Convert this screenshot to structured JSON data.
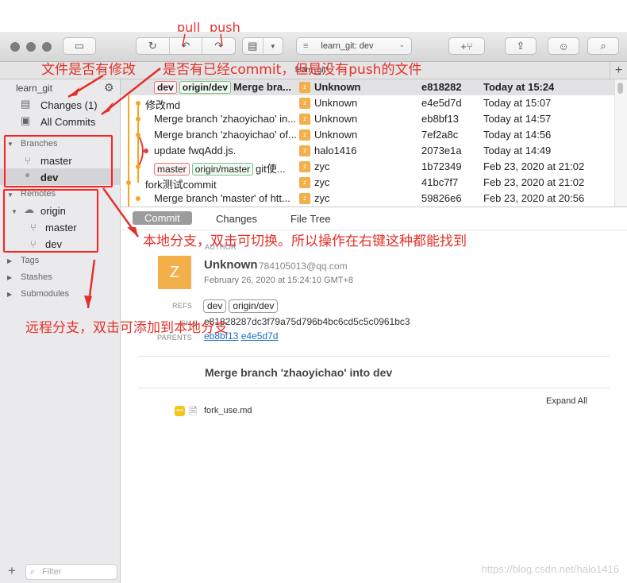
{
  "annotations": {
    "pull": "pull",
    "push": "push",
    "file_modified": "文件是否有修改",
    "committed_not_pushed": "是否有已经commit，但是没有push的文件",
    "local_branch_note": "本地分支，双击可切换。所以操作在右键这种都能找到",
    "remote_branch_note": "远程分支，双击可添加到本地分支",
    "accent": "#e5302a"
  },
  "toolbar": {
    "branch_select": "learn_git: dev",
    "icons": [
      "sidebar-toggle-icon",
      "fetch-icon",
      "pull-icon",
      "push-icon",
      "stash-icon",
      "branch-icon",
      "share-icon",
      "smiley-icon",
      "search-icon"
    ]
  },
  "tab": {
    "title": "learn_git*"
  },
  "sidebar": {
    "repo": "learn_git",
    "changes": "Changes (1)",
    "all_commits": "All Commits",
    "branches_header": "Branches",
    "branches": [
      "master",
      "dev"
    ],
    "remotes_header": "Remotes",
    "remote_name": "origin",
    "remote_branches": [
      "master",
      "dev"
    ],
    "tags": "Tags",
    "stashes": "Stashes",
    "submodules": "Submodules",
    "filter_placeholder": "Filter",
    "add": "+"
  },
  "commits": [
    {
      "tags": [
        {
          "t": "dev",
          "k": "local"
        },
        {
          "t": "origin/dev",
          "k": "remote"
        }
      ],
      "message": "Merge bra...",
      "avatar": "z",
      "author": "Unknown",
      "hash": "e818282",
      "date": "Today at 15:24"
    },
    {
      "tags": [],
      "message": "修改md",
      "avatar": "z",
      "author": "Unknown",
      "hash": "e4e5d7d",
      "date": "Today at 15:07"
    },
    {
      "tags": [],
      "message": "Merge branch 'zhaoyichao' in...",
      "avatar": "z",
      "author": "Unknown",
      "hash": "eb8bf13",
      "date": "Today at 14:57"
    },
    {
      "tags": [],
      "message": "Merge branch 'zhaoyichao' of...",
      "avatar": "z",
      "author": "Unknown",
      "hash": "7ef2a8c",
      "date": "Today at 14:56"
    },
    {
      "tags": [],
      "message": "update fwqAdd.js.",
      "avatar": "z",
      "author": "halo1416",
      "hash": "2073e1a",
      "date": "Today at 14:49"
    },
    {
      "tags": [
        {
          "t": "master",
          "k": "local"
        },
        {
          "t": "origin/master",
          "k": "remote"
        }
      ],
      "message": "git使...",
      "avatar": "z",
      "author": "zyc",
      "hash": "1b72349",
      "date": "Feb 23, 2020 at 21:02"
    },
    {
      "tags": [],
      "message": "fork测试commit",
      "avatar": "z",
      "author": "zyc",
      "hash": "41bc7f7",
      "date": "Feb 23, 2020 at 21:02"
    },
    {
      "tags": [],
      "message": "Merge branch 'master' of htt...",
      "avatar": "z",
      "author": "zyc",
      "hash": "59826e6",
      "date": "Feb 23, 2020 at 20:56"
    }
  ],
  "detail_tabs": [
    "Commit",
    "Changes",
    "File Tree"
  ],
  "detail": {
    "author_label": "AUTHOR",
    "avatar": "Z",
    "author_name": "Unknown",
    "author_email": "784105013@qq.com",
    "date": "February 26, 2020 at 15:24:10 GMT+8",
    "refs_label": "REFS",
    "refs": [
      "dev",
      "origin/dev"
    ],
    "sha_label": "SHA",
    "sha": "e81828287dc3f79a75d796b4bc6cd5c5c0961bc3",
    "parents_label": "PARENTS",
    "parents": [
      "eb8bf13",
      "e4e5d7d"
    ],
    "message": "Merge branch 'zhaoyichao' into dev",
    "expand_all": "Expand All",
    "file": "fork_use.md"
  },
  "watermark": "https://blog.csdn.net/halo1416"
}
